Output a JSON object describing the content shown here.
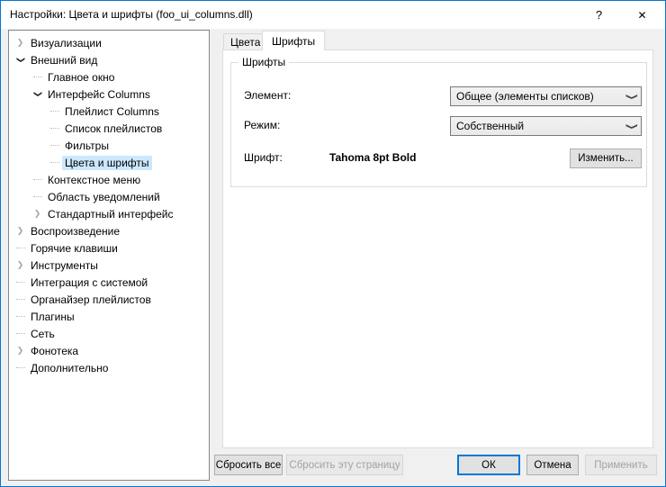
{
  "window": {
    "title": "Настройки: Цвета и шрифты (foo_ui_columns.dll)",
    "help_glyph": "?",
    "close_glyph": "✕"
  },
  "tree": {
    "items": [
      {
        "label": "Визуализации",
        "level": 0,
        "state": "collapsed",
        "selected": false
      },
      {
        "label": "Внешний вид",
        "level": 0,
        "state": "expanded",
        "selected": false
      },
      {
        "label": "Главное окно",
        "level": 1,
        "state": "leaf",
        "selected": false
      },
      {
        "label": "Интерфейс Columns",
        "level": 1,
        "state": "expanded",
        "selected": false
      },
      {
        "label": "Плейлист Columns",
        "level": 2,
        "state": "leaf",
        "selected": false
      },
      {
        "label": "Список плейлистов",
        "level": 2,
        "state": "leaf",
        "selected": false
      },
      {
        "label": "Фильтры",
        "level": 2,
        "state": "leaf",
        "selected": false
      },
      {
        "label": "Цвета и шрифты",
        "level": 2,
        "state": "leaf",
        "selected": true
      },
      {
        "label": "Контекстное меню",
        "level": 1,
        "state": "leaf",
        "selected": false
      },
      {
        "label": "Область уведомлений",
        "level": 1,
        "state": "leaf",
        "selected": false
      },
      {
        "label": "Стандартный интерфейс",
        "level": 1,
        "state": "collapsed",
        "selected": false
      },
      {
        "label": "Воспроизведение",
        "level": 0,
        "state": "collapsed",
        "selected": false
      },
      {
        "label": "Горячие клавиши",
        "level": 0,
        "state": "leaf",
        "selected": false
      },
      {
        "label": "Инструменты",
        "level": 0,
        "state": "collapsed",
        "selected": false
      },
      {
        "label": "Интеграция с системой",
        "level": 0,
        "state": "leaf",
        "selected": false
      },
      {
        "label": "Органайзер плейлистов",
        "level": 0,
        "state": "leaf",
        "selected": false
      },
      {
        "label": "Плагины",
        "level": 0,
        "state": "leaf",
        "selected": false
      },
      {
        "label": "Сеть",
        "level": 0,
        "state": "leaf",
        "selected": false
      },
      {
        "label": "Фонотека",
        "level": 0,
        "state": "collapsed",
        "selected": false
      },
      {
        "label": "Дополнительно",
        "level": 0,
        "state": "leaf",
        "selected": false
      }
    ]
  },
  "tabs": [
    {
      "label": "Цвета",
      "active": false
    },
    {
      "label": "Шрифты",
      "active": true
    }
  ],
  "panel": {
    "group_title": "Шрифты",
    "element_label": "Элемент:",
    "element_value": "Общее (элементы списков)",
    "mode_label": "Режим:",
    "mode_value": "Собственный",
    "font_label": "Шрифт:",
    "font_value": "Tahoma 8pt Bold",
    "change_button": "Изменить..."
  },
  "footer": {
    "reset_all": "Сбросить все",
    "reset_page": "Сбросить эту страницу",
    "ok": "ОК",
    "cancel": "Отмена",
    "apply": "Применить"
  },
  "colors": {
    "accent": "#0078d7",
    "selection": "#cce8ff",
    "titlebar_bg": "#ffffff",
    "dialog_bg": "#f0f0f0"
  }
}
